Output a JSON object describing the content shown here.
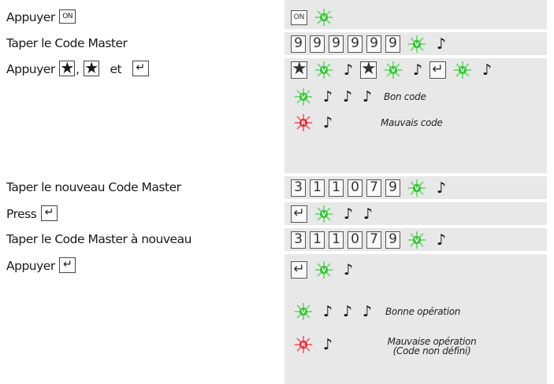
{
  "left": {
    "row1_text": "Appuyer",
    "row2_text": "Taper le Code Master",
    "row3_text": "Appuyer",
    "row3_comma": ",",
    "row3_et": "et",
    "row4_text": "Taper le nouveau Code Master",
    "row5_text": "Press",
    "row6_text": "Taper le Code Master à nouveau",
    "row7_text": "Appuyer"
  },
  "keys": {
    "on": "ON",
    "star": "★",
    "enter": "↵"
  },
  "led": {
    "green_letter": "V",
    "red_letter": "R",
    "green_color": "#3bc43b",
    "red_color": "#e0303b",
    "ray_green": "#7ed87e",
    "ray_red": "#f07080"
  },
  "note_glyph": "♪",
  "codes": {
    "master": [
      "9",
      "9",
      "9",
      "9",
      "9",
      "9"
    ],
    "new_master": [
      "3",
      "1",
      "1",
      "0",
      "7",
      "9"
    ],
    "new_master_repeat": [
      "3",
      "1",
      "1",
      "0",
      "7",
      "9"
    ]
  },
  "messages": {
    "good_code": "Bon code",
    "bad_code": "Mauvais code",
    "good_op": "Bonne opération",
    "bad_op_line1": "Mauvaise opération",
    "bad_op_line2": "(Code non défini)"
  },
  "colors": {
    "panel_bg": "#e8e8e8"
  }
}
